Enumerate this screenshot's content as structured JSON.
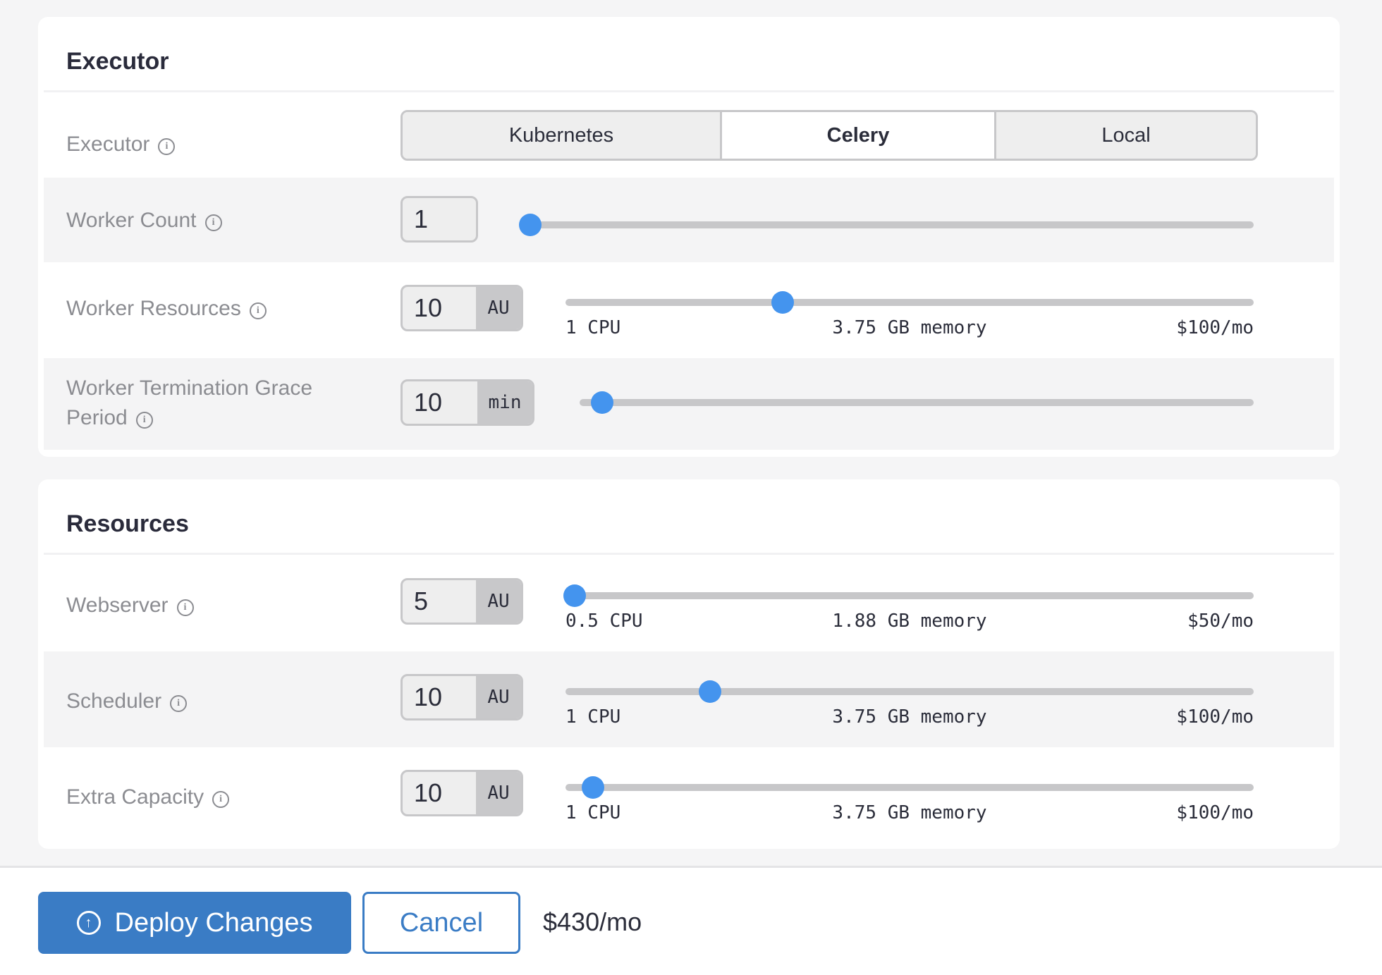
{
  "executor_card": {
    "title": "Executor",
    "executor": {
      "label": "Executor",
      "options": [
        "Kubernetes",
        "Celery",
        "Local"
      ],
      "selected": "Celery"
    },
    "worker_count": {
      "label": "Worker Count",
      "value": "1",
      "slider_fraction": 0.0
    },
    "worker_resources": {
      "label": "Worker Resources",
      "value": "10",
      "unit": "AU",
      "slider_fraction": 0.316,
      "cpu": "1 CPU",
      "memory": "3.75 GB memory",
      "cost": "$100/mo"
    },
    "grace_period": {
      "label_line1": "Worker Termination Grace",
      "label_line2": "Period",
      "value": "10",
      "unit": "min",
      "slider_fraction": 0.033
    }
  },
  "resources_card": {
    "title": "Resources",
    "webserver": {
      "label": "Webserver",
      "value": "5",
      "unit": "AU",
      "slider_fraction": 0.013,
      "cpu": "0.5 CPU",
      "memory": "1.88 GB memory",
      "cost": "$50/mo"
    },
    "scheduler": {
      "label": "Scheduler",
      "value": "10",
      "unit": "AU",
      "slider_fraction": 0.21,
      "cpu": "1 CPU",
      "memory": "3.75 GB memory",
      "cost": "$100/mo"
    },
    "extra_capacity": {
      "label": "Extra Capacity",
      "value": "10",
      "unit": "AU",
      "slider_fraction": 0.04,
      "cpu": "1 CPU",
      "memory": "3.75 GB memory",
      "cost": "$100/mo"
    }
  },
  "footer": {
    "deploy_label": "Deploy Changes",
    "cancel_label": "Cancel",
    "total": "$430/mo"
  },
  "colors": {
    "accent": "#3a7cc5",
    "slider_knob": "#4494ee"
  },
  "icons": {
    "info": "info-icon",
    "deploy": "arrow-up-circle-icon"
  }
}
